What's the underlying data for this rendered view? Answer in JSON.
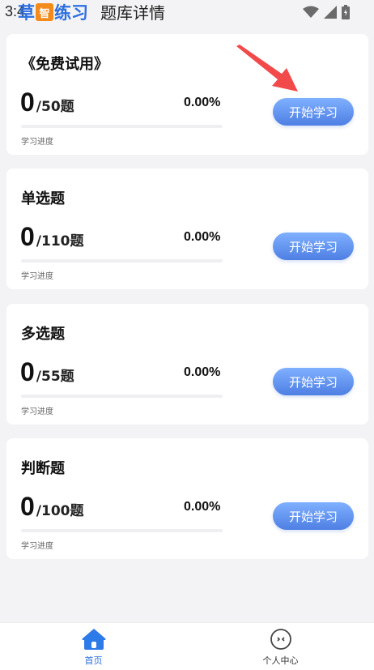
{
  "status_bar": {
    "time": "3:4"
  },
  "header": {
    "logo_pre": "草",
    "logo_badge": "智",
    "logo_post": "练习",
    "title": "题库详情"
  },
  "cards": [
    {
      "title": "《免费试用》",
      "done": "0",
      "total": "/50题",
      "percent": "0.00%",
      "progress": 0.0,
      "progress_label": "学习进度",
      "button": "开始学习"
    },
    {
      "title": "单选题",
      "done": "0",
      "total": "/110题",
      "percent": "0.00%",
      "progress": 0.0,
      "progress_label": "学习进度",
      "button": "开始学习"
    },
    {
      "title": "多选题",
      "done": "0",
      "total": "/55题",
      "percent": "0.00%",
      "progress": 0.0,
      "progress_label": "学习进度",
      "button": "开始学习"
    },
    {
      "title": "判断题",
      "done": "0",
      "total": "/100题",
      "percent": "0.00%",
      "progress": 0.0,
      "progress_label": "学习进度",
      "button": "开始学习"
    }
  ],
  "bottom_nav": {
    "home": {
      "label": "首页",
      "icon": "home-icon"
    },
    "me": {
      "label": "个人中心",
      "icon": "face-icon"
    }
  },
  "colors": {
    "accent": "#2d6fe0",
    "button_top": "#7fb0ff",
    "button_bottom": "#4e7fe3",
    "arrow": "#f24a4a"
  }
}
